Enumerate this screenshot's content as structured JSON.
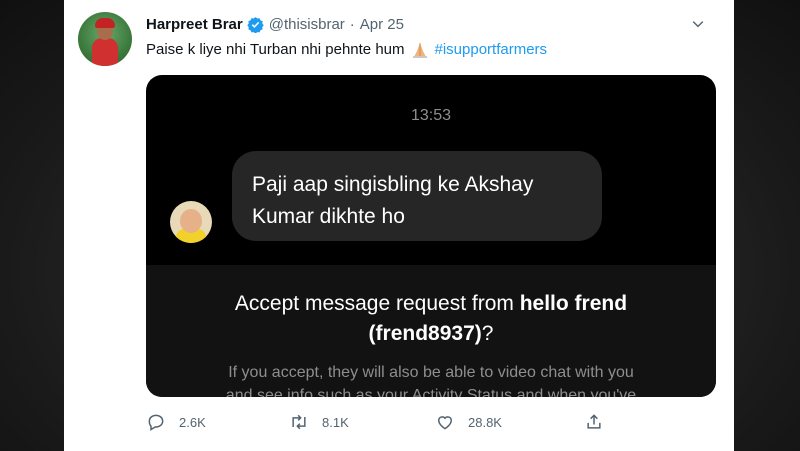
{
  "tweet": {
    "author_name": "Harpreet Brar",
    "handle": "@thisisbrar",
    "separator": "·",
    "date": "Apr 25",
    "text_main": "Paise k liye nhi Turban nhi pehnte hum",
    "hashtag": "#isupportfarmers",
    "accent_color": "#1d9bf0"
  },
  "media": {
    "time": "13:53",
    "message_line1": "Paji aap singisbling ke Akshay",
    "message_line2": "Kumar dikhte ho",
    "request_prefix": "Accept message request from ",
    "request_name": "hello frend",
    "request_username": "(frend8937)",
    "request_suffix": "?",
    "request_desc_line1": "If you accept, they will also be able to video chat with you",
    "request_desc_line2": "and see info such as your Activity Status and when you've"
  },
  "actions": {
    "replies": "2.6K",
    "retweets": "8.1K",
    "likes": "28.8K"
  }
}
